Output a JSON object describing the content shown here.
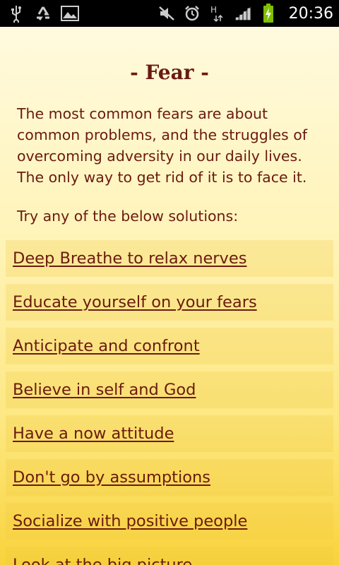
{
  "status_bar": {
    "time": "20:36",
    "icons_left": [
      "usb-icon",
      "recycle-icon",
      "image-icon"
    ],
    "icons_right": [
      "mute-icon",
      "alarm-icon",
      "data-hplus-icon",
      "signal-icon",
      "battery-charging-icon"
    ]
  },
  "page": {
    "title": "- Fear -",
    "intro": "The most common fears are about common problems, and the struggles of overcoming adversity in our daily lives. The only way to get rid of it is to face it.",
    "try_label": "Try any of the below solutions:",
    "solutions": [
      "Deep Breathe to relax nerves",
      "Educate yourself on your fears",
      "Anticipate and confront",
      "Believe in self and God",
      "Have a now attitude",
      "Don't go by assumptions",
      "Socialize with positive people",
      "Look at the big picture"
    ]
  },
  "colors": {
    "text": "#6b1a10",
    "bg_top": "#fffbe3",
    "bg_bottom": "#f9d33c"
  }
}
